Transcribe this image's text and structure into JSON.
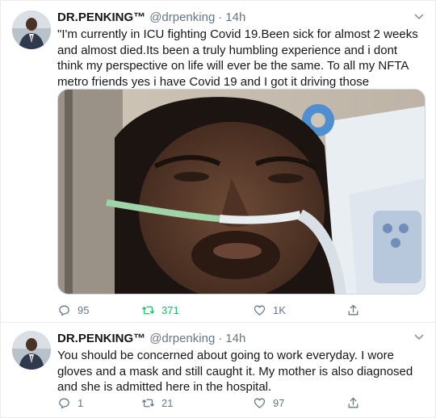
{
  "tweets": [
    {
      "name": "DR.PENKING™",
      "handle": "@drpenking",
      "separator": "·",
      "time": "14h",
      "text": "\"I'm currently in ICU fighting Covid 19.Been sick for almost 2 weeks and almost died.Its been a truly humbling experience and i dont think my perspective on life will ever be the same. To all my NFTA metro friends yes i have Covid 19 and I got it driving those contaminated buses.",
      "stats": {
        "replies": "95",
        "retweets": "371",
        "likes": "1K"
      }
    },
    {
      "name": "DR.PENKING™",
      "handle": "@drpenking",
      "separator": "·",
      "time": "14h",
      "text": "You should be concerned about going to work everyday. I wore gloves and a mask and still caught it. My mother is also diagnosed  and she is admitted here in the hospital.",
      "stats": {
        "replies": "1",
        "retweets": "21",
        "likes": "97"
      }
    }
  ],
  "icons": {
    "reply": "speech-bubble",
    "retweet": "retweet-arrows",
    "like": "heart",
    "share": "upload-arrow",
    "menu": "chevron-down"
  },
  "colors": {
    "text": "#14171a",
    "muted": "#657786",
    "retweeted": "#17bf63",
    "border": "#e6ecf0"
  }
}
